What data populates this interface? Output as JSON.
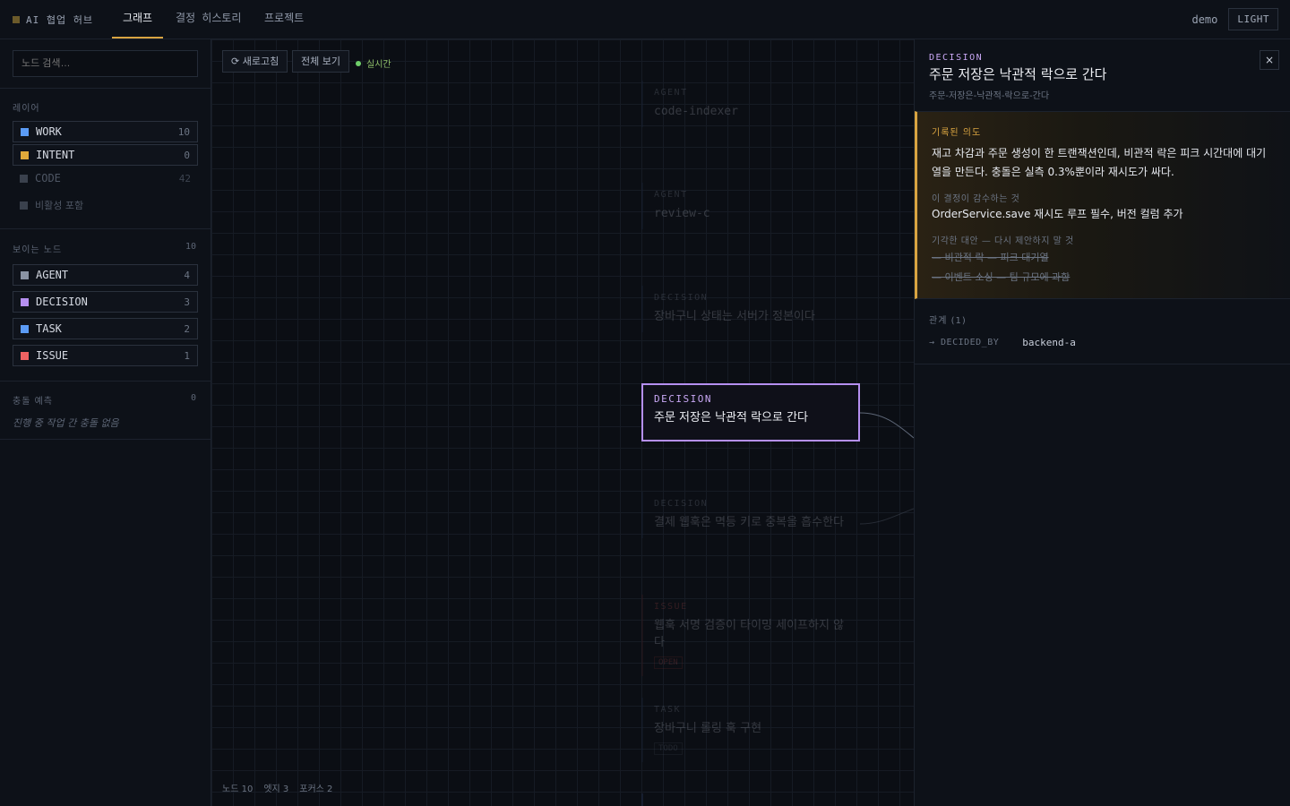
{
  "app": {
    "brand": "AI 협업 허브",
    "tabs": [
      {
        "label": "그래프",
        "active": true
      },
      {
        "label": "결정 히스토리",
        "active": false
      },
      {
        "label": "프로젝트",
        "active": false
      }
    ],
    "user": "demo",
    "theme_button": "LIGHT"
  },
  "sidebar": {
    "search_placeholder": "노드 검색…",
    "layers_label": "레이어",
    "layers": [
      {
        "name": "WORK",
        "count": "10",
        "color": "#5b9bf5",
        "enabled": true
      },
      {
        "name": "INTENT",
        "count": "0",
        "color": "#e0a93a",
        "enabled": true
      },
      {
        "name": "CODE",
        "count": "42",
        "color": "#3a414d",
        "enabled": false
      },
      {
        "name": "비활성 포함",
        "count": "",
        "color": "#3a414d",
        "enabled": false
      }
    ],
    "visible_label": "보이는 노드",
    "visible_count": "10",
    "visible_types": [
      {
        "name": "AGENT",
        "count": "4",
        "color": "#8a93a3"
      },
      {
        "name": "DECISION",
        "count": "3",
        "color": "#b58ff0"
      },
      {
        "name": "TASK",
        "count": "2",
        "color": "#5b9bf5"
      },
      {
        "name": "ISSUE",
        "count": "1",
        "color": "#f06262"
      }
    ],
    "conflict_label": "충돌 예측",
    "conflict_count": "0",
    "conflict_empty": "진행 중 작업 간 충돌 없음"
  },
  "canvas": {
    "refresh": "⟳ 새로고침",
    "fit": "전체 보기",
    "live": "실시간",
    "nodes": [
      {
        "type": "AGENT",
        "title": "code-indexer",
        "badge": ""
      },
      {
        "type": "AGENT",
        "title": "review-c",
        "badge": ""
      },
      {
        "type": "DECISION",
        "title": "장바구니 상태는 서버가 정본이다",
        "badge": ""
      },
      {
        "type": "DECISION",
        "title": "결제 웹훅은 멱등 키로 중복을 흡수한다",
        "badge": ""
      },
      {
        "type": "ISSUE",
        "title": "웹훅 서명 검증이 타이밍 세이프하지 않다",
        "badge": "OPEN"
      },
      {
        "type": "TASK",
        "title": "장바구니 롤링 훅 구현",
        "badge": "TODO"
      }
    ],
    "selected": {
      "type": "DECISION",
      "title": "주문 저장은 낙관적 락으로 간다"
    },
    "status": {
      "nodes": "노드 10",
      "edges": "엣지 3",
      "focus": "포커스 2"
    }
  },
  "panel": {
    "type": "DECISION",
    "title": "주문 저장은 낙관적 락으로 간다",
    "slug": "주문-저장은-낙관적-락으로-간다",
    "close": "×",
    "intent_label": "기록된 의도",
    "intent_body": "재고 차감과 주문 생성이 한 트랜잭션인데, 비관적 락은 피크 시간대에 대기열을 만든다. 충돌은 실측 0.3%뿐이라 재시도가 싸다.",
    "accepts_label": "이 결정이 감수하는 것",
    "accepts_value": "OrderService.save 재시도 루프 필수, 버전 컬럼 추가",
    "rejected_label": "기각한 대안 — 다시 제안하지 말 것",
    "rejected": [
      "— 비관적 락 — 피크 대기열",
      "— 이벤트 소싱 — 팀 규모에 과함"
    ],
    "relations_label": "관계 (1)",
    "relations": [
      {
        "type": "→ DECIDED_BY",
        "target": "backend-a"
      }
    ]
  }
}
